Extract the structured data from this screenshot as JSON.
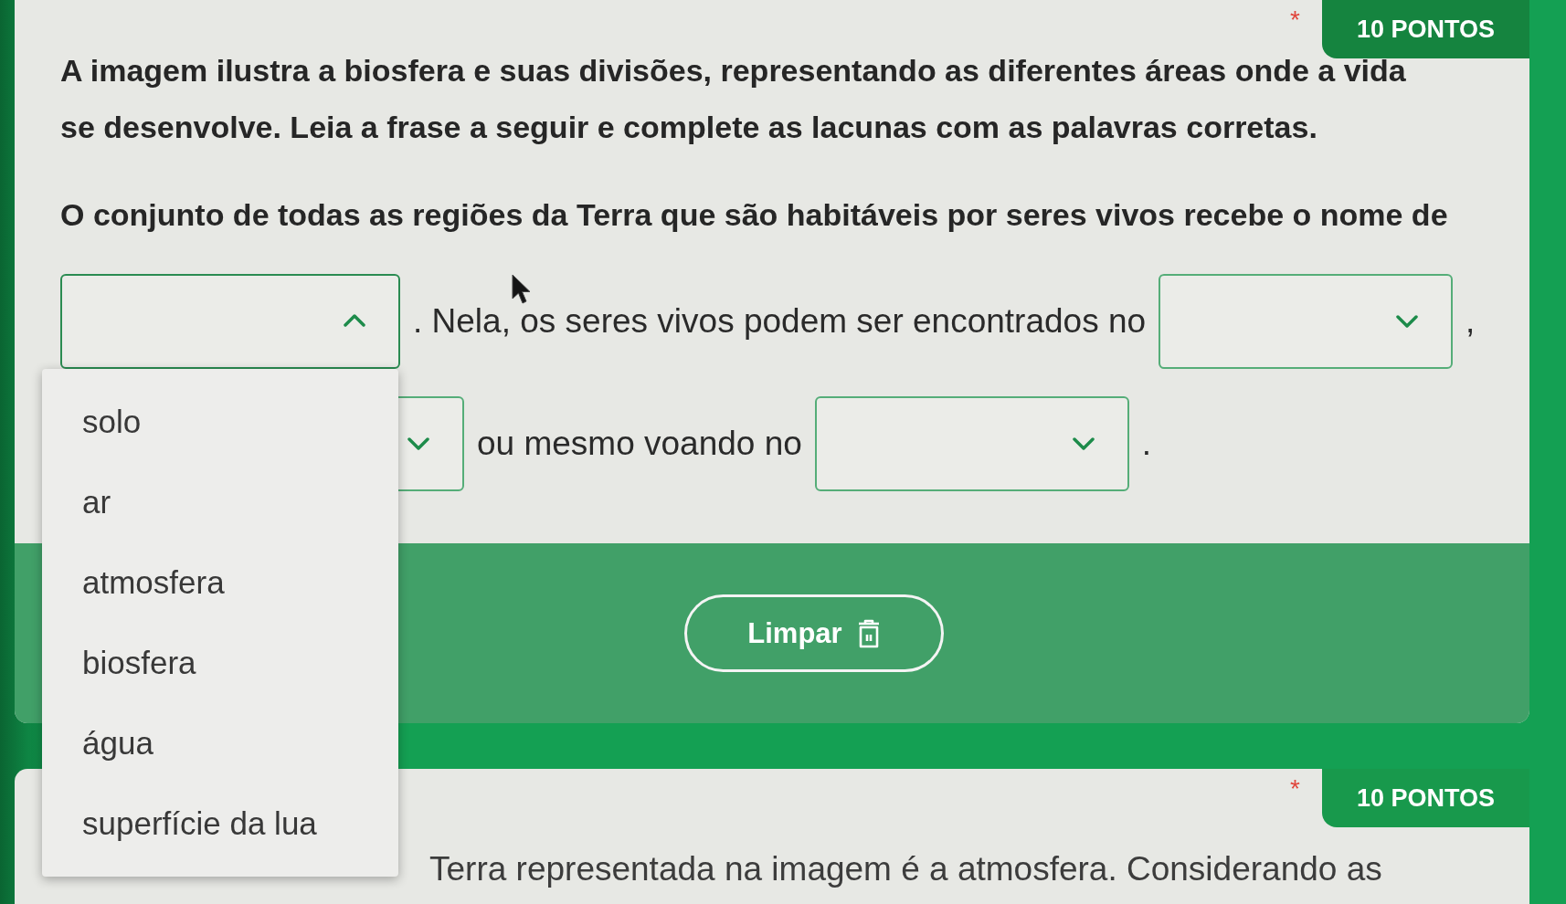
{
  "questions": [
    {
      "required_mark": "*",
      "points": "10 PONTOS",
      "intro": "A imagem ilustra a biosfera e suas divisões, representando as diferentes áreas onde a vida se desenvolve. Leia a frase a seguir e complete as lacunas com as palavras corretas.",
      "statement": "O conjunto de todas as regiões da Terra que são habitáveis por seres vivos recebe o nome de",
      "blanks": [
        {
          "kind": "select",
          "open": true,
          "options": [
            {
              "label": "solo",
              "selected": false
            },
            {
              "label": "ar",
              "selected": false
            },
            {
              "label": "atmosfera",
              "selected": false
            },
            {
              "label": "biosfera",
              "selected": false
            },
            {
              "label": "água",
              "selected": false
            },
            {
              "label": "superfície da lua",
              "selected": false
            }
          ]
        },
        {
          "kind": "text",
          "text": ". Nela, os seres vivos podem ser encontrados no"
        },
        {
          "kind": "select",
          "open": false
        },
        {
          "kind": "text",
          "text": ","
        },
        {
          "kind": "select",
          "open": false
        },
        {
          "kind": "text",
          "text": "ou mesmo voando no"
        },
        {
          "kind": "select",
          "open": false
        },
        {
          "kind": "text",
          "text": "."
        }
      ],
      "clear_button": {
        "label": "Limpar"
      }
    },
    {
      "required_mark": "*",
      "points": "10 PONTOS",
      "text": "Terra representada na imagem é a atmosfera. Considerando as"
    }
  ]
}
